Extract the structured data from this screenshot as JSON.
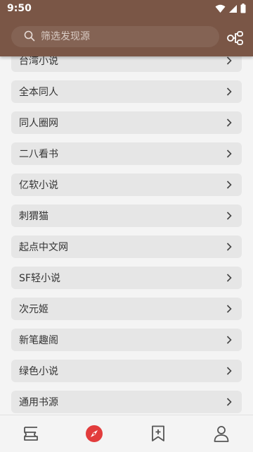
{
  "status_bar": {
    "time": "9:50"
  },
  "search": {
    "placeholder": "筛选发现源"
  },
  "sources": [
    "台湾小说",
    "全本同人",
    "同人圈网",
    "二八看书",
    "亿软小说",
    "刺猬猫",
    "起点中文网",
    "SF轻小说",
    "次元姬",
    "新笔趣阁",
    "绿色小说",
    "通用书源"
  ],
  "bottom_nav": {
    "items": [
      "bookshelf-icon",
      "compass-icon",
      "bookmark-add-icon",
      "person-icon"
    ],
    "active_index": 1
  },
  "colors": {
    "header": "#7a5646",
    "accent": "#e23c3c",
    "item_bg": "#e6e6e6",
    "page_bg": "#f4f4f4"
  }
}
